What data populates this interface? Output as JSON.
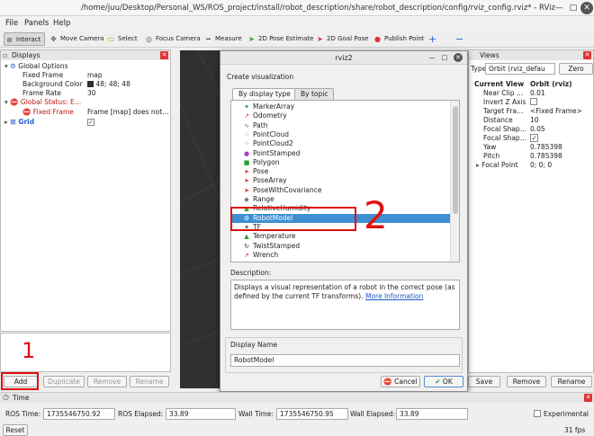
{
  "window": {
    "title": "/home/juu/Desktop/Personal_WS/ROS_project/install/robot_description/share/robot_description/config/rviz_config.rviz* - RViz"
  },
  "menu": [
    "File",
    "Panels",
    "Help"
  ],
  "toolbar": {
    "interact": "Interact",
    "move_camera": "Move Camera",
    "select": "Select",
    "focus_camera": "Focus Camera",
    "measure": "Measure",
    "pose_estimate": "2D Pose Estimate",
    "goal_pose": "2D Goal Pose",
    "publish_point": "Publish Point",
    "add_icon": "+",
    "remove_icon": "−"
  },
  "displays": {
    "header": "Displays",
    "global_options": "Global Options",
    "fixed_frame_label": "Fixed Frame",
    "fixed_frame_value": "map",
    "bg_color_label": "Background Color",
    "bg_color_value": "48; 48; 48",
    "frame_rate_label": "Frame Rate",
    "frame_rate_value": "30",
    "global_status": "Global Status: E…",
    "fixed_frame_err_label": "Fixed Frame",
    "fixed_frame_err_value": "Frame [map] does not…",
    "grid": "Grid",
    "grid_checked": "✓",
    "buttons": {
      "add": "Add",
      "duplicate": "Duplicate",
      "remove": "Remove",
      "rename": "Rename"
    }
  },
  "views": {
    "header": "Views",
    "type_label": "Type:",
    "type_value": "Orbit (rviz_defau",
    "zero": "Zero",
    "current_view": "Current View",
    "current_view_value": "Orbit (rviz)",
    "props": [
      {
        "name": "Near Clip …",
        "value": "0.01"
      },
      {
        "name": "Invert Z Axis",
        "value": ""
      },
      {
        "name": "Target Fra…",
        "value": "<Fixed Frame>"
      },
      {
        "name": "Distance",
        "value": "10"
      },
      {
        "name": "Focal Shap…",
        "value": "0.05"
      },
      {
        "name": "Focal Shap…",
        "value": "✓"
      },
      {
        "name": "Yaw",
        "value": "0.785398"
      },
      {
        "name": "Pitch",
        "value": "0.785398"
      },
      {
        "name": "Focal Point",
        "value": "0; 0; 0"
      }
    ],
    "buttons": {
      "save": "Save",
      "remove": "Remove",
      "rename": "Rename"
    }
  },
  "dialog": {
    "title": "rviz2",
    "heading": "Create visualization",
    "tab_display_type": "By display type",
    "tab_topic": "By topic",
    "items": [
      {
        "label": "MarkerArray",
        "icon": "✦",
        "color": "#2a8f3a"
      },
      {
        "label": "Odometry",
        "icon": "↗",
        "color": "#d33"
      },
      {
        "label": "Path",
        "icon": "∿",
        "color": "#2a8f3a"
      },
      {
        "label": "PointCloud",
        "icon": "⁘",
        "color": "#2a5fd3"
      },
      {
        "label": "PointCloud2",
        "icon": "⁘",
        "color": "#2a5fd3"
      },
      {
        "label": "PointStamped",
        "icon": "●",
        "color": "#b33ad3"
      },
      {
        "label": "Polygon",
        "icon": "■",
        "color": "#2a9f2a"
      },
      {
        "label": "Pose",
        "icon": "➤",
        "color": "#d33"
      },
      {
        "label": "PoseArray",
        "icon": "➤",
        "color": "#d33"
      },
      {
        "label": "PoseWithCovariance",
        "icon": "➤",
        "color": "#d33"
      },
      {
        "label": "Range",
        "icon": "◆",
        "color": "#777"
      },
      {
        "label": "RelativeHumidity",
        "icon": "▲",
        "color": "#2a9f2a"
      },
      {
        "label": "RobotModel",
        "icon": "⚙",
        "color": "#555"
      },
      {
        "label": "TF",
        "icon": "✶",
        "color": "#333"
      },
      {
        "label": "Temperature",
        "icon": "▲",
        "color": "#2a9f2a"
      },
      {
        "label": "TwistStamped",
        "icon": "↻",
        "color": "#333"
      },
      {
        "label": "Wrench",
        "icon": "↗",
        "color": "#d33"
      }
    ],
    "selected_index": 12,
    "description_label": "Description:",
    "description_text": "Displays a visual representation of a robot in the correct pose (as defined by the current TF transforms).",
    "description_link": "More Information",
    "display_name_label": "Display Name",
    "display_name_value": "RobotModel",
    "cancel": "Cancel",
    "ok": "OK"
  },
  "time": {
    "header": "Time",
    "ros_time_label": "ROS Time:",
    "ros_time_value": "1735546750.92",
    "ros_elapsed_label": "ROS Elapsed:",
    "ros_elapsed_value": "33.89",
    "wall_time_label": "Wall Time:",
    "wall_time_value": "1735546750.95",
    "wall_elapsed_label": "Wall Elapsed:",
    "wall_elapsed_value": "33.89",
    "experimental": "Experimental",
    "reset": "Reset",
    "fps": "31 fps"
  },
  "annotations": {
    "one": "1",
    "two": "2"
  }
}
